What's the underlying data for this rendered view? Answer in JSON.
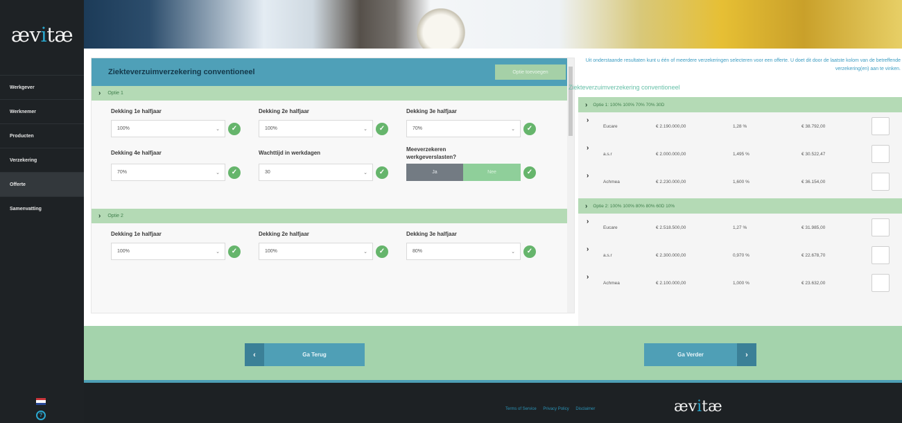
{
  "brand": {
    "logo_text_a": "æv",
    "logo_dot": "i",
    "logo_text_b": "tæ"
  },
  "sidebar": {
    "items": [
      {
        "label": "Werkgever"
      },
      {
        "label": "Werknemer"
      },
      {
        "label": "Producten"
      },
      {
        "label": "Verzekering"
      },
      {
        "label": "Offerte"
      },
      {
        "label": "Samenvatting"
      }
    ],
    "active_index": 4
  },
  "card": {
    "title": "Ziekteverzuimverzekering conventioneel",
    "add_option_label": "Optie toevoegen"
  },
  "option1": {
    "label": "Optie 1",
    "fields": {
      "h1_label": "Dekking 1e halfjaar",
      "h1_value": "100%",
      "h2_label": "Dekking 2e halfjaar",
      "h2_value": "100%",
      "h3_label": "Dekking 3e halfjaar",
      "h3_value": "70%",
      "h4_label": "Dekking 4e halfjaar",
      "h4_value": "70%",
      "wait_label": "Wachttijd in werkdagen",
      "wait_value": "30",
      "insure_label": "Meeverzekeren werkgeverslasten?",
      "yes": "Ja",
      "no": "Nee"
    }
  },
  "option2": {
    "label": "Optie 2",
    "fields": {
      "h1_label": "Dekking 1e halfjaar",
      "h1_value": "100%",
      "h2_label": "Dekking 2e halfjaar",
      "h2_value": "100%",
      "h3_label": "Dekking 3e halfjaar",
      "h3_value": "80%"
    }
  },
  "results": {
    "intro": "Uit onderstaande resultaten kunt u één of meerdere verzekeringen selecteren voor een offerte. U doet dit door de laatste kolom van de betreffende verzekering(en) aan te vinken.",
    "section_label": "Ziekteverzuimverzekering conventioneel",
    "groups": [
      {
        "label": "Optie 1: 100% 100% 70% 70% 30D",
        "rows": [
          {
            "insurer": "Eucare",
            "amount": "€ 2.190.000,00",
            "pct": "1,28 %",
            "premium": "€ 38.792,00"
          },
          {
            "insurer": "a.s.r",
            "amount": "€ 2.000.000,00",
            "pct": "1,495 %",
            "premium": "€ 30.522,47"
          },
          {
            "insurer": "Achmea",
            "amount": "€ 2.230.000,00",
            "pct": "1,600 %",
            "premium": "€ 36.154,00"
          }
        ]
      },
      {
        "label": "Optie 2: 100% 100% 80% 80% 60D 10%",
        "rows": [
          {
            "insurer": "Eucare",
            "amount": "€ 2.518.500,00",
            "pct": "1,27 %",
            "premium": "€ 31.985,00"
          },
          {
            "insurer": "a.s.r",
            "amount": "€ 2.300.000,00",
            "pct": "0,970 %",
            "premium": "€ 22.678,70"
          },
          {
            "insurer": "Achmea",
            "amount": "€ 2.100.000,00",
            "pct": "1,000 %",
            "premium": "€ 23.632,00"
          }
        ]
      }
    ]
  },
  "actions": {
    "back_label": "Ga Terug",
    "next_label": "Ga Verder",
    "back_arrow": "‹",
    "next_arrow": "›"
  },
  "footer": {
    "links": [
      "Terms of Service",
      "Privacy Policy",
      "Disclaimer"
    ]
  },
  "colors": {
    "accent": "#4fa0b8",
    "green_bar": "#a4d3ac",
    "check": "#66b56c",
    "dark": "#1d2124"
  }
}
